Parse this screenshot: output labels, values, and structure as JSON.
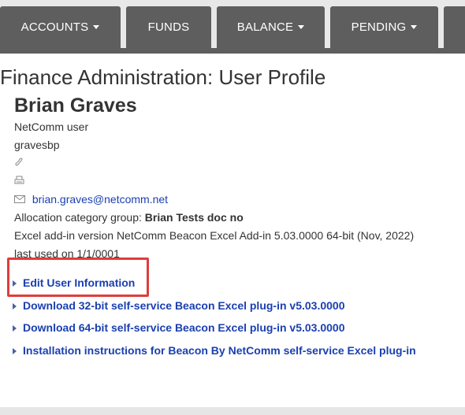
{
  "nav": {
    "accounts": "ACCOUNTS",
    "funds": "FUNDS",
    "balance": "BALANCE",
    "pending": "PENDING"
  },
  "page_title": "Finance Administration: User Profile",
  "profile": {
    "name": "Brian Graves",
    "role": "NetComm user",
    "username": "gravesbp",
    "phone_icon": "phone-icon",
    "fax_icon": "fax-icon",
    "email_icon": "envelope-icon",
    "email": "brian.graves@netcomm.net",
    "allocation_label": "Allocation category group:",
    "allocation_value": "Brian Tests doc no",
    "excel_addin": "Excel add-in version NetComm Beacon Excel Add-in 5.03.0000 64-bit (Nov, 2022)",
    "last_used": "last used on 1/1/0001"
  },
  "actions": [
    "Edit User Information",
    "Download 32-bit self-service Beacon Excel plug-in v5.03.0000",
    "Download 64-bit self-service Beacon Excel plug-in v5.03.0000",
    "Installation instructions for Beacon By NetComm self-service Excel plug-in"
  ],
  "colors": {
    "nav_bg": "#5e5e5e",
    "link": "#1a3fb0",
    "highlight": "#e03c3c"
  }
}
